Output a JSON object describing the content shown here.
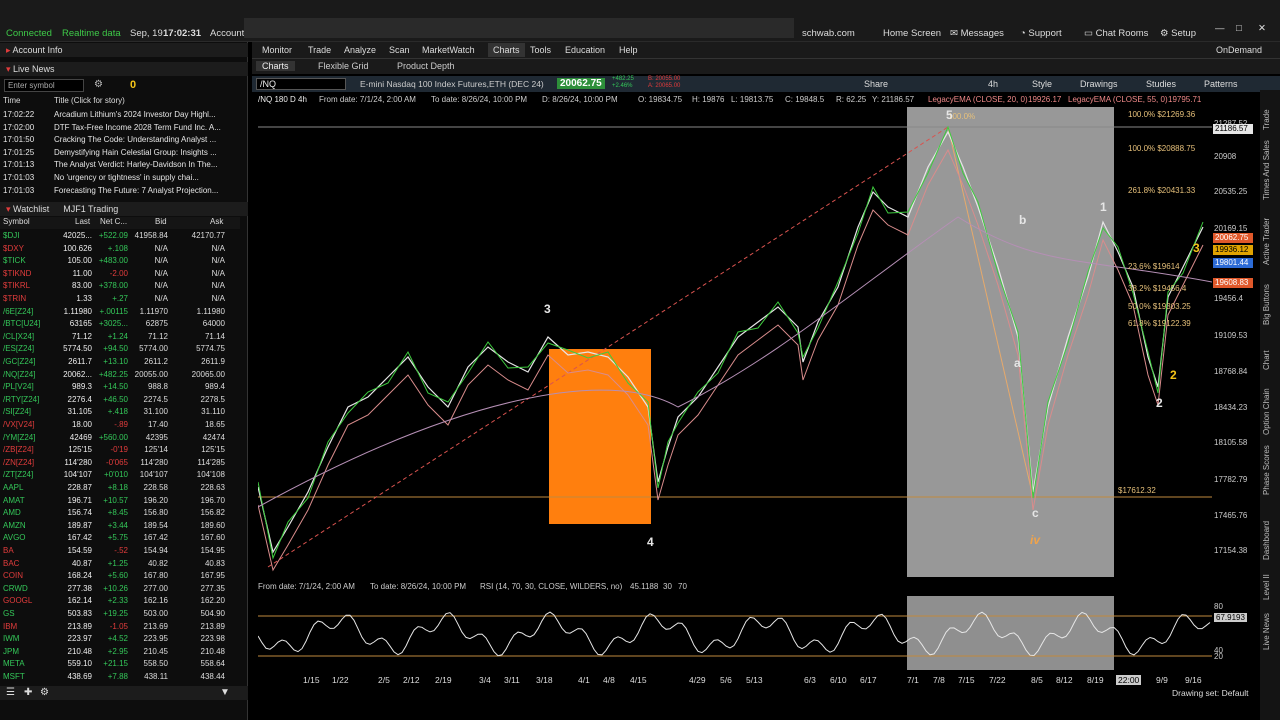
{
  "system_bar": {
    "connected": "Connected",
    "realtime": "Realtime data",
    "date": "Sep, 19",
    "time": "17:02:31",
    "account": "Account",
    "brand": "schwab.com",
    "home_screen": "Home Screen",
    "messages": "Messages",
    "support": "Support",
    "chat_rooms": "Chat Rooms",
    "setup": "Setup"
  },
  "left_panel": {
    "account_info": "Account Info",
    "live_news": "Live News",
    "symbol_input_placeholder": "Enter symbol",
    "news_count": "0",
    "news_headers": [
      "Time",
      "Title (Click for story)"
    ],
    "news": [
      {
        "time": "17:02:22",
        "title": "Arcadium Lithium's 2024 Investor Day Highl..."
      },
      {
        "time": "17:02:00",
        "title": "DTF Tax-Free Income 2028 Term Fund Inc. A..."
      },
      {
        "time": "17:01:50",
        "title": "Cracking The Code: Understanding Analyst ..."
      },
      {
        "time": "17:01:25",
        "title": "Demystifying Hain Celestial Group: Insights ..."
      },
      {
        "time": "17:01:13",
        "title": "The Analyst Verdict: Harley-Davidson In The..."
      },
      {
        "time": "17:01:03",
        "title": "No 'urgency or tightness' in supply chai..."
      },
      {
        "time": "17:01:03",
        "title": "Forecasting The Future: 7 Analyst Projection..."
      }
    ],
    "watchlist_label": "Watchlist",
    "watchlist_name": "MJF1 Trading",
    "watchlist_headers": [
      "Symbol",
      "Last",
      "Net C...",
      "Bid",
      "Ask"
    ],
    "watchlist": [
      {
        "symbol": "$DJI",
        "last": "42025...",
        "net": "+522.09",
        "bid": "41958.84",
        "ask": "42170.77",
        "up": true
      },
      {
        "symbol": "$DXY",
        "last": "100.626",
        "net": "+.108",
        "bid": "N/A",
        "ask": "N/A",
        "up": false
      },
      {
        "symbol": "$TICK",
        "last": "105.00",
        "net": "+483.00",
        "bid": "N/A",
        "ask": "N/A",
        "up": true
      },
      {
        "symbol": "$TIKND",
        "last": "11.00",
        "net": "-2.00",
        "bid": "N/A",
        "ask": "N/A",
        "up": false
      },
      {
        "symbol": "$TIKRL",
        "last": "83.00",
        "net": "+378.00",
        "bid": "N/A",
        "ask": "N/A",
        "up": false
      },
      {
        "symbol": "$TRIN",
        "last": "1.33",
        "net": "+.27",
        "bid": "N/A",
        "ask": "N/A",
        "up": false
      },
      {
        "symbol": "/6E[Z24]",
        "last": "1.11980",
        "net": "+.00115",
        "bid": "1.11970",
        "ask": "1.11980",
        "up": true
      },
      {
        "symbol": "/BTC[U24]",
        "last": "63165",
        "net": "+3025...",
        "bid": "62875",
        "ask": "64000",
        "up": true
      },
      {
        "symbol": "/CL[X24]",
        "last": "71.12",
        "net": "+1.24",
        "bid": "71.12",
        "ask": "71.14",
        "up": true
      },
      {
        "symbol": "/ES[Z24]",
        "last": "5774.50",
        "net": "+94.50",
        "bid": "5774.00",
        "ask": "5774.75",
        "up": true
      },
      {
        "symbol": "/GC[Z24]",
        "last": "2611.7",
        "net": "+13.10",
        "bid": "2611.2",
        "ask": "2611.9",
        "up": true
      },
      {
        "symbol": "/NQ[Z24]",
        "last": "20062...",
        "net": "+482.25",
        "bid": "20055.00",
        "ask": "20065.00",
        "up": true
      },
      {
        "symbol": "/PL[V24]",
        "last": "989.3",
        "net": "+14.50",
        "bid": "988.8",
        "ask": "989.4",
        "up": true
      },
      {
        "symbol": "/RTY[Z24]",
        "last": "2276.4",
        "net": "+46.50",
        "bid": "2274.5",
        "ask": "2278.5",
        "up": true
      },
      {
        "symbol": "/SI[Z24]",
        "last": "31.105",
        "net": "+.418",
        "bid": "31.100",
        "ask": "31.110",
        "up": true
      },
      {
        "symbol": "/VX[V24]",
        "last": "18.00",
        "net": "-.89",
        "bid": "17.40",
        "ask": "18.65",
        "up": false
      },
      {
        "symbol": "/YM[Z24]",
        "last": "42469",
        "net": "+560.00",
        "bid": "42395",
        "ask": "42474",
        "up": true
      },
      {
        "symbol": "/ZB[Z24]",
        "last": "125'15",
        "net": "-0'19",
        "bid": "125'14",
        "ask": "125'15",
        "up": false
      },
      {
        "symbol": "/ZN[Z24]",
        "last": "114'280",
        "net": "-0'065",
        "bid": "114'280",
        "ask": "114'285",
        "up": false
      },
      {
        "symbol": "/ZT[Z24]",
        "last": "104'107",
        "net": "+0'010",
        "bid": "104'107",
        "ask": "104'108",
        "up": true
      },
      {
        "symbol": "AAPL",
        "last": "228.87",
        "net": "+8.18",
        "bid": "228.58",
        "ask": "228.63",
        "up": true
      },
      {
        "symbol": "AMAT",
        "last": "196.71",
        "net": "+10.57",
        "bid": "196.20",
        "ask": "196.70",
        "up": true
      },
      {
        "symbol": "AMD",
        "last": "156.74",
        "net": "+8.45",
        "bid": "156.80",
        "ask": "156.82",
        "up": true
      },
      {
        "symbol": "AMZN",
        "last": "189.87",
        "net": "+3.44",
        "bid": "189.54",
        "ask": "189.60",
        "up": true
      },
      {
        "symbol": "AVGO",
        "last": "167.42",
        "net": "+5.75",
        "bid": "167.42",
        "ask": "167.60",
        "up": true
      },
      {
        "symbol": "BA",
        "last": "154.59",
        "net": "-.52",
        "bid": "154.94",
        "ask": "154.95",
        "up": false
      },
      {
        "symbol": "BAC",
        "last": "40.87",
        "net": "+1.25",
        "bid": "40.82",
        "ask": "40.83",
        "up": false
      },
      {
        "symbol": "COIN",
        "last": "168.24",
        "net": "+5.60",
        "bid": "167.80",
        "ask": "167.95",
        "up": false
      },
      {
        "symbol": "CRWD",
        "last": "277.38",
        "net": "+10.26",
        "bid": "277.00",
        "ask": "277.35",
        "up": true
      },
      {
        "symbol": "GOOGL",
        "last": "162.14",
        "net": "+2.33",
        "bid": "162.16",
        "ask": "162.20",
        "up": false
      },
      {
        "symbol": "GS",
        "last": "503.83",
        "net": "+19.25",
        "bid": "503.00",
        "ask": "504.90",
        "up": true
      },
      {
        "symbol": "IBM",
        "last": "213.89",
        "net": "-1.05",
        "bid": "213.69",
        "ask": "213.89",
        "up": false
      },
      {
        "symbol": "IWM",
        "last": "223.97",
        "net": "+4.52",
        "bid": "223.95",
        "ask": "223.98",
        "up": true
      },
      {
        "symbol": "JPM",
        "last": "210.48",
        "net": "+2.95",
        "bid": "210.45",
        "ask": "210.48",
        "up": true
      },
      {
        "symbol": "META",
        "last": "559.10",
        "net": "+21.15",
        "bid": "558.50",
        "ask": "558.64",
        "up": true
      },
      {
        "symbol": "MSFT",
        "last": "438.69",
        "net": "+7.88",
        "bid": "438.11",
        "ask": "438.44",
        "up": true
      }
    ]
  },
  "menu": [
    "Monitor",
    "Trade",
    "Analyze",
    "Scan",
    "MarketWatch",
    "Charts",
    "Tools",
    "Education",
    "Help"
  ],
  "ondemand": "OnDemand",
  "tabs": [
    "Charts",
    "Flexible Grid",
    "Product Depth"
  ],
  "symbol_bar": {
    "symbol": "/NQ",
    "description": "E-mini Nasdaq 100 Index Futures,ETH (DEC 24)",
    "price": "20062.75",
    "change1": "+482.25",
    "change2": "+2.46%",
    "bid": "B: 20055.00",
    "ask": "A: 20065.00",
    "share": "Share",
    "timeframe": "4h",
    "style": "Style",
    "drawings": "Drawings",
    "studies": "Studies",
    "patterns": "Patterns"
  },
  "info_bar": {
    "title": "/NQ 180 D 4h",
    "from": "From date: 7/1/24, 2:00 AM",
    "to": "To date: 8/26/24, 10:00 PM",
    "d": "D: 8/26/24, 10:00 PM",
    "o": "O: 19834.75",
    "h": "H: 19876",
    "l": "L: 19813.75",
    "c": "C: 19848.5",
    "r": "R: 62.25",
    "y": "Y: 21186.57",
    "ema20": "LegacyEMA (CLOSE, 20, 0)",
    "ema20_val": "19926.17",
    "ema55": "LegacyEMA (CLOSE, 55, 0)",
    "ema55_val": "19795.71"
  },
  "rsi_info": {
    "from": "From date: 7/1/24, 2:00 AM",
    "to": "To date: 8/26/24, 10:00 PM",
    "label": "RSI (14, 70, 30, CLOSE, WILDERS, no)",
    "value": "45.1188",
    "p30": "30",
    "p70": "70"
  },
  "y_axis": [
    "21287.52",
    "20908",
    "20535.25",
    "20169.15",
    "19456.4",
    "19109.53",
    "18768.84",
    "18434.23",
    "18105.58",
    "17782.79",
    "17465.76",
    "17154.38"
  ],
  "y_badges": [
    {
      "text": "21186.57",
      "color": "#e6e6e6",
      "tcolor": "#000"
    },
    {
      "text": "20062.75",
      "color": "#e0582a",
      "tcolor": "#fff"
    },
    {
      "text": "19936.12",
      "color": "#e0a300",
      "tcolor": "#000"
    },
    {
      "text": "19801.44",
      "color": "#2c6bd6",
      "tcolor": "#fff"
    },
    {
      "text": "19608.83",
      "color": "#e0582a",
      "tcolor": "#fff"
    }
  ],
  "rsi_axis": [
    "80",
    "67.9193",
    "40",
    "20"
  ],
  "fib_labels": [
    {
      "pct": "100.0%",
      "val": "$21269.36"
    },
    {
      "pct": "100.0%",
      "val": "$20888.75"
    },
    {
      "pct": "261.8%",
      "val": "$20431.33"
    },
    {
      "pct": "23.6%",
      "val": "$19614"
    },
    {
      "pct": "38.2%",
      "val": "$19456.4"
    },
    {
      "pct": "50.0%",
      "val": "$19303.25"
    },
    {
      "pct": "61.8%",
      "val": "$19122.39"
    },
    {
      "pct": "",
      "val": "$17612.32"
    },
    {
      "pct": "100.0%",
      "val": ""
    }
  ],
  "wave_labels": [
    "3",
    "4",
    "5",
    "b",
    "a",
    "c",
    "iv",
    "1",
    "2",
    "2",
    "3"
  ],
  "x_axis": [
    "1/15",
    "1/22",
    "2/5",
    "2/12",
    "2/19",
    "3/4",
    "3/11",
    "3/18",
    "4/1",
    "4/8",
    "4/15",
    "4/29",
    "5/6",
    "5/13",
    "6/3",
    "6/10",
    "6/17",
    "7/1",
    "7/8",
    "7/15",
    "7/22",
    "8/5",
    "8/12",
    "8/19",
    "22:00",
    "9/9",
    "9/16"
  ],
  "right_tabs": [
    "Trade",
    "Times And Sales",
    "Active Trader",
    "Big Buttons",
    "Chart",
    "Option Chain",
    "Phase Scores",
    "Dashboard",
    "Level II",
    "Live News"
  ],
  "drawing_set": "Drawing set: Default",
  "colors": {
    "up": "#34c759",
    "down": "#e13c3c",
    "accent": "#1e90ff",
    "orange": "#ff7f0e"
  }
}
